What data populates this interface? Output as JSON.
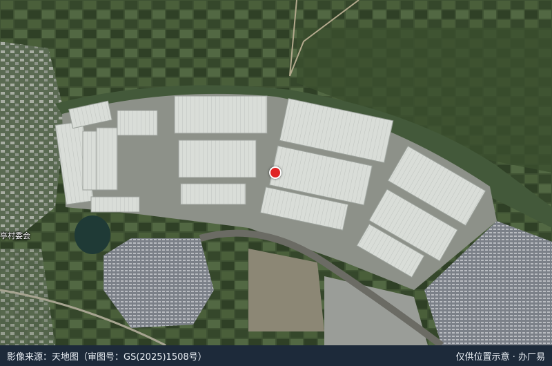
{
  "map": {
    "place_label": "亭村委会",
    "attribution_left": "影像来源：天地图（审图号：GS(2025)1508号）",
    "attribution_right": "仅供位置示意 · 办厂易",
    "marker": "location-pin-icon"
  }
}
